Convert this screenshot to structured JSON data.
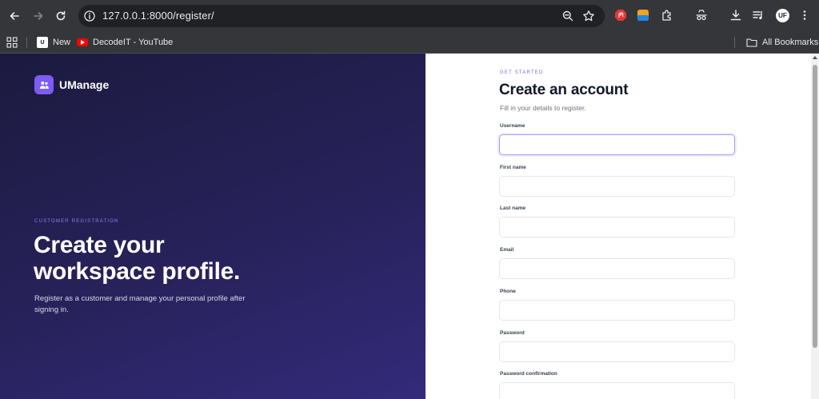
{
  "browser": {
    "url": "127.0.0.1:8000/register/",
    "icons": [
      "back-arrow-icon",
      "forward-arrow-icon",
      "reload-icon",
      "info-icon",
      "zoom-icon",
      "star-icon",
      "puzzle-icon",
      "download-icon",
      "media-icon",
      "menu-dots-icon"
    ],
    "profile_initials": "UF",
    "bookmarks": [
      {
        "label": "New",
        "favicon": "uf-favicon"
      },
      {
        "label": "DecodeIT - YouTube",
        "favicon": "youtube-favicon"
      }
    ],
    "all_bookmarks_label": "All Bookmarks",
    "colors": {
      "chrome": "#35363a",
      "omnibox": "#202124"
    }
  },
  "left": {
    "brand_name": "UManage",
    "brand_icon": "users-icon",
    "eyebrow": "CUSTOMER REGISTRATION",
    "hero_line1": "Create your",
    "hero_line2": "workspace profile.",
    "subtitle": "Register as a customer and manage your personal profile after signing in.",
    "accent": "#7c5cf5"
  },
  "form": {
    "eyebrow": "GET STARTED",
    "title": "Create an account",
    "subtitle": "Fill in your details to register.",
    "fields": [
      {
        "label": "Username",
        "value": ""
      },
      {
        "label": "First name",
        "value": ""
      },
      {
        "label": "Last name",
        "value": ""
      },
      {
        "label": "Email",
        "value": ""
      },
      {
        "label": "Phone",
        "value": ""
      },
      {
        "label": "Password",
        "value": ""
      },
      {
        "label": "Password confirmation",
        "value": ""
      }
    ]
  }
}
